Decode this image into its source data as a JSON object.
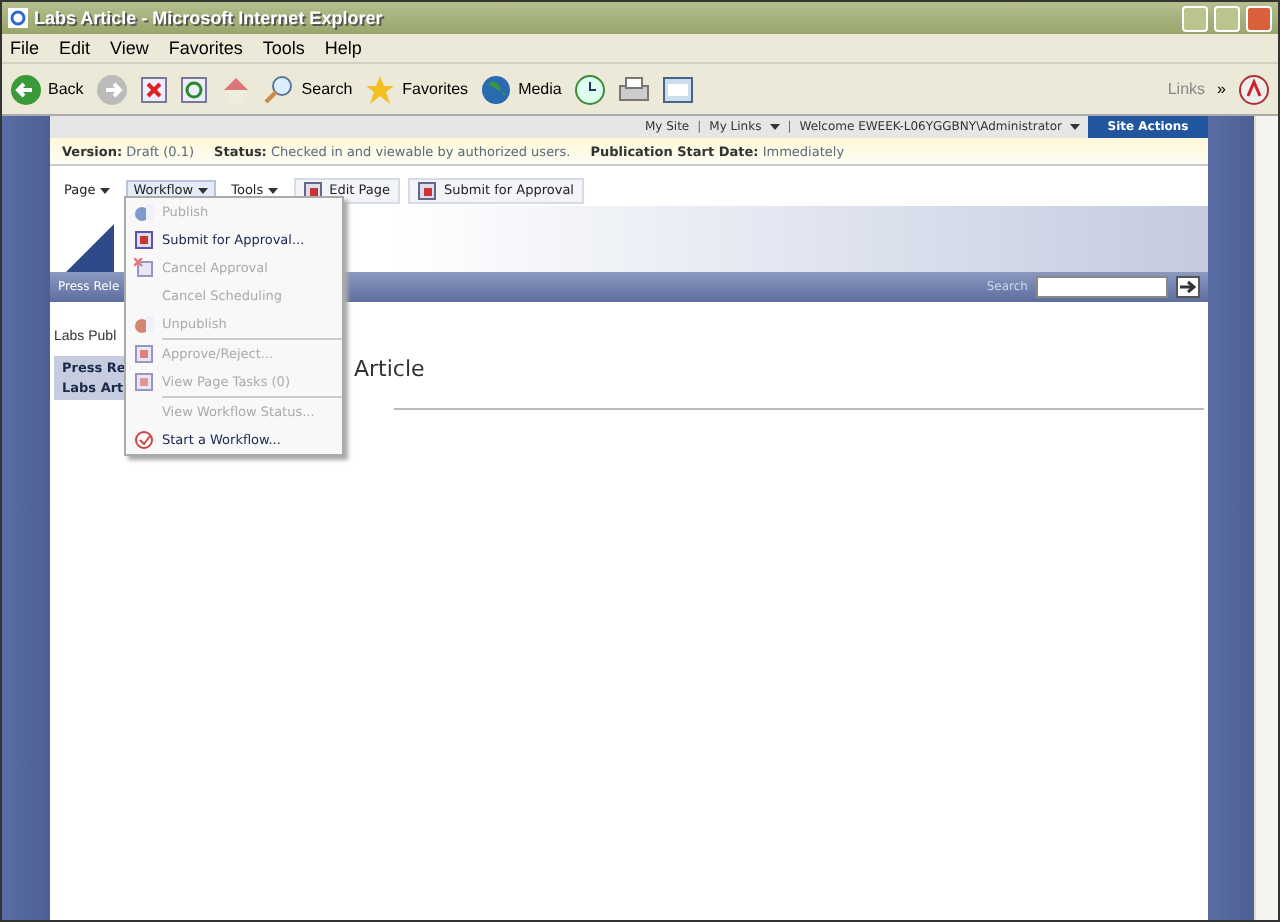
{
  "window": {
    "title": "Labs Article - Microsoft Internet Explorer"
  },
  "menu_bar": [
    "File",
    "Edit",
    "View",
    "Favorites",
    "Tools",
    "Help"
  ],
  "toolbar": {
    "back": "Back",
    "search": "Search",
    "favorites": "Favorites",
    "media": "Media",
    "links": "Links",
    "chevron": "»"
  },
  "top_links": {
    "my_site": "My Site",
    "my_links": "My Links",
    "welcome": "Welcome EWEEK-L06YGGBNY\\Administrator",
    "site_actions": "Site Actions",
    "separators": [
      "|",
      "|"
    ]
  },
  "status_bar": [
    {
      "label": "Version:",
      "value": "Draft (0.1)"
    },
    {
      "label": "Status:",
      "value": "Checked in and viewable by authorized users."
    },
    {
      "label": "Publication Start Date:",
      "value": "Immediately"
    }
  ],
  "edit_toolbar": {
    "menus": [
      {
        "label": "Page",
        "selected": false
      },
      {
        "label": "Workflow",
        "selected": true
      },
      {
        "label": "Tools",
        "selected": false
      }
    ],
    "buttons": [
      "Edit Page",
      "Submit for Approval"
    ]
  },
  "nav": {
    "tab": "Press Rele",
    "search_label": "Search"
  },
  "content": {
    "site_title": "Labs Publ",
    "breadcrumb": [
      "Press Re",
      "Labs Art"
    ],
    "heading": "Article"
  },
  "workflow_menu": {
    "groups": [
      [
        {
          "label": "Publish",
          "kind": "publish",
          "disabled": true
        },
        {
          "label": "Submit for Approval...",
          "kind": "submit",
          "disabled": false
        },
        {
          "label": "Cancel Approval",
          "kind": "cancel",
          "disabled": true
        },
        {
          "label": "Cancel Scheduling",
          "kind": "plain",
          "disabled": true
        },
        {
          "label": "Unpublish",
          "kind": "unpublish",
          "disabled": true
        }
      ],
      [
        {
          "label": "Approve/Reject...",
          "kind": "approve",
          "disabled": true
        },
        {
          "label": "View Page Tasks (0)",
          "kind": "tasks",
          "disabled": true
        }
      ],
      [
        {
          "label": "View Workflow Status...",
          "kind": "plain",
          "disabled": true
        },
        {
          "label": "Start a Workflow...",
          "kind": "workflow",
          "disabled": false
        }
      ]
    ]
  }
}
